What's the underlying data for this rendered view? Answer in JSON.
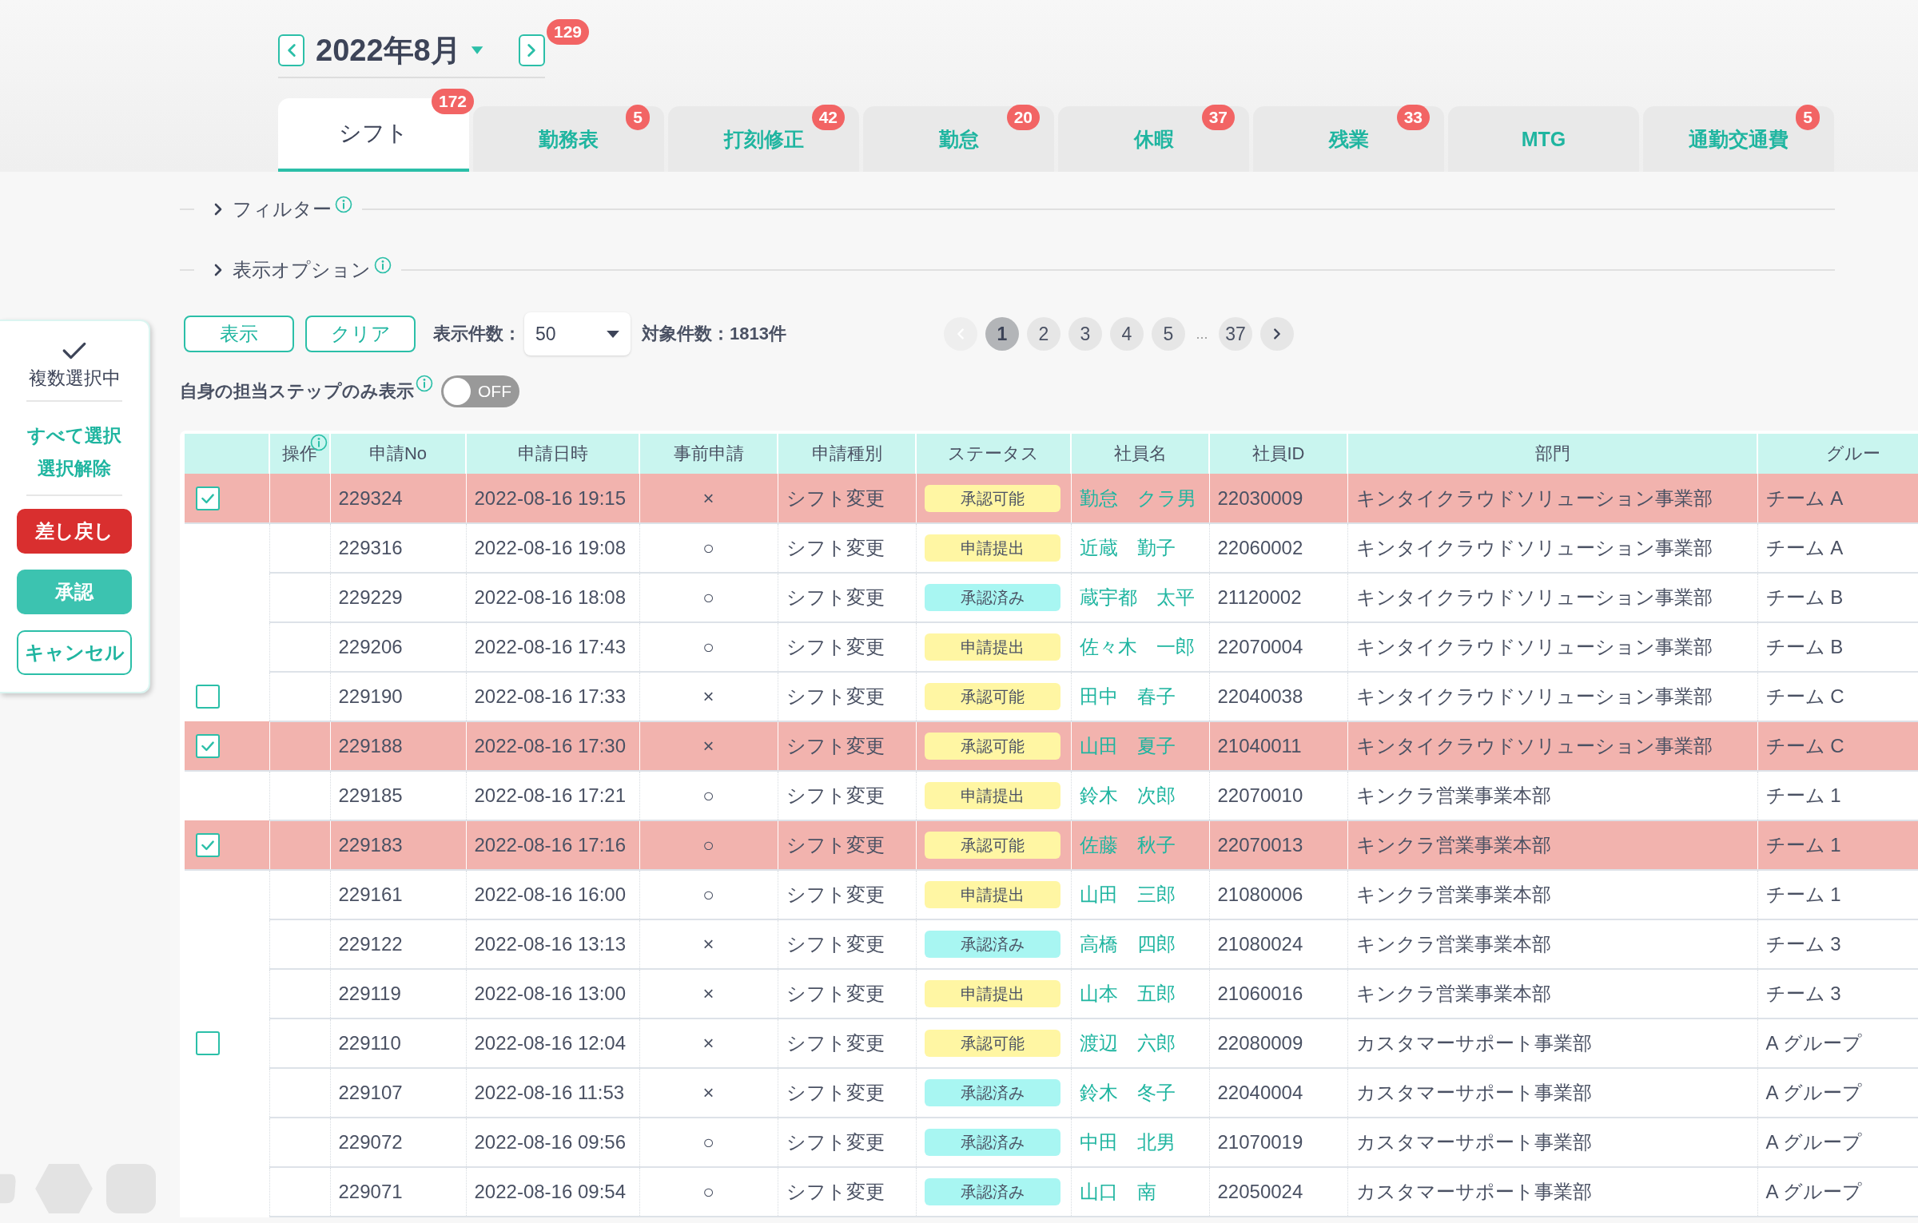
{
  "month_nav": {
    "title": "2022年8月",
    "badge": "129"
  },
  "tabs": [
    {
      "label": "シフト",
      "badge": "172",
      "selected": true
    },
    {
      "label": "勤務表",
      "badge": "5",
      "selected": false
    },
    {
      "label": "打刻修正",
      "badge": "42",
      "selected": false
    },
    {
      "label": "勤怠",
      "badge": "20",
      "selected": false
    },
    {
      "label": "休暇",
      "badge": "37",
      "selected": false
    },
    {
      "label": "残業",
      "badge": "33",
      "selected": false
    },
    {
      "label": "MTG",
      "selected": false
    },
    {
      "label": "通勤交通費",
      "badge": "5",
      "selected": false
    }
  ],
  "sections": [
    {
      "label": "フィルター",
      "expanded": false
    },
    {
      "label": "表示オプション",
      "expanded": false
    }
  ],
  "side_panel": {
    "mode": "複数選択中",
    "links": [
      "すべて選択",
      "選択解除"
    ],
    "buttons": [
      {
        "label": "差し戻し",
        "kind": "danger"
      },
      {
        "label": "承認",
        "kind": "primary"
      },
      {
        "label": "キャンセル",
        "kind": "outline"
      }
    ]
  },
  "toolbar": {
    "buttons": [
      "表示",
      "クリア"
    ],
    "page_size_label": "表示件数：",
    "page_size": "50",
    "total": "対象件数：1813件"
  },
  "pagination": [
    {
      "kind": "prev",
      "disabled": true
    },
    {
      "kind": "page",
      "label": "1",
      "selected": true
    },
    {
      "kind": "page",
      "label": "2",
      "selected": false
    },
    {
      "kind": "page",
      "label": "3",
      "selected": false
    },
    {
      "kind": "page",
      "label": "4",
      "selected": false
    },
    {
      "kind": "page",
      "label": "5",
      "selected": false
    },
    {
      "kind": "ellipsis",
      "label": "..."
    },
    {
      "kind": "page",
      "label": "37",
      "selected": false
    },
    {
      "kind": "next",
      "disabled": false
    }
  ],
  "toggle": {
    "label": "自身の担当ステップのみ表示",
    "on": false,
    "state_label": "OFF"
  },
  "table": {
    "columns": [
      {
        "label": "操作",
        "info": true
      },
      {
        "label": "申請No"
      },
      {
        "label": "申請日時"
      },
      {
        "label": "事前申請"
      },
      {
        "label": "申請種別"
      },
      {
        "label": "ステータス"
      },
      {
        "label": "社員名"
      },
      {
        "label": "社員ID"
      },
      {
        "label": "部門"
      },
      {
        "label": "グルー"
      }
    ],
    "rows": [
      {
        "has_checkbox": true,
        "checked": true,
        "no": "229324",
        "datetime": "2022-08-16 19:15",
        "prior": "×",
        "type": "シフト変更",
        "status": {
          "label": "承認可能",
          "color": "#fff6a3"
        },
        "employee": "勤怠　クラ男",
        "employee_id": "22030009",
        "department": "キンタイクラウドソリューション事業部",
        "group": "チーム A"
      },
      {
        "has_checkbox": false,
        "checked": false,
        "no": "229316",
        "datetime": "2022-08-16 19:08",
        "prior": "○",
        "type": "シフト変更",
        "status": {
          "label": "申請提出",
          "color": "#fff6a3"
        },
        "employee": "近蔵　勤子",
        "employee_id": "22060002",
        "department": "キンタイクラウドソリューション事業部",
        "group": "チーム A"
      },
      {
        "has_checkbox": false,
        "checked": false,
        "no": "229229",
        "datetime": "2022-08-16 18:08",
        "prior": "○",
        "type": "シフト変更",
        "status": {
          "label": "承認済み",
          "color": "#a8f6f2"
        },
        "employee": "蔵宇都　太平",
        "employee_id": "21120002",
        "department": "キンタイクラウドソリューション事業部",
        "group": "チーム B"
      },
      {
        "has_checkbox": false,
        "checked": false,
        "no": "229206",
        "datetime": "2022-08-16 17:43",
        "prior": "○",
        "type": "シフト変更",
        "status": {
          "label": "申請提出",
          "color": "#fff6a3"
        },
        "employee": "佐々木　一郎",
        "employee_id": "22070004",
        "department": "キンタイクラウドソリューション事業部",
        "group": "チーム B"
      },
      {
        "has_checkbox": true,
        "checked": false,
        "no": "229190",
        "datetime": "2022-08-16 17:33",
        "prior": "×",
        "type": "シフト変更",
        "status": {
          "label": "承認可能",
          "color": "#fff6a3"
        },
        "employee": "田中　春子",
        "employee_id": "22040038",
        "department": "キンタイクラウドソリューション事業部",
        "group": "チーム C"
      },
      {
        "has_checkbox": true,
        "checked": true,
        "no": "229188",
        "datetime": "2022-08-16 17:30",
        "prior": "×",
        "type": "シフト変更",
        "status": {
          "label": "承認可能",
          "color": "#fff6a3"
        },
        "employee": "山田　夏子",
        "employee_id": "21040011",
        "department": "キンタイクラウドソリューション事業部",
        "group": "チーム C"
      },
      {
        "has_checkbox": false,
        "checked": false,
        "no": "229185",
        "datetime": "2022-08-16 17:21",
        "prior": "○",
        "type": "シフト変更",
        "status": {
          "label": "申請提出",
          "color": "#fff6a3"
        },
        "employee": "鈴木　次郎",
        "employee_id": "22070010",
        "department": "キンクラ営業事業本部",
        "group": "チーム 1"
      },
      {
        "has_checkbox": true,
        "checked": true,
        "no": "229183",
        "datetime": "2022-08-16 17:16",
        "prior": "○",
        "type": "シフト変更",
        "status": {
          "label": "承認可能",
          "color": "#fff6a3"
        },
        "employee": "佐藤　秋子",
        "employee_id": "22070013",
        "department": "キンクラ営業事業本部",
        "group": "チーム 1"
      },
      {
        "has_checkbox": false,
        "checked": false,
        "no": "229161",
        "datetime": "2022-08-16 16:00",
        "prior": "○",
        "type": "シフト変更",
        "status": {
          "label": "申請提出",
          "color": "#fff6a3"
        },
        "employee": "山田　三郎",
        "employee_id": "21080006",
        "department": "キンクラ営業事業本部",
        "group": "チーム 1"
      },
      {
        "has_checkbox": false,
        "checked": false,
        "no": "229122",
        "datetime": "2022-08-16 13:13",
        "prior": "×",
        "type": "シフト変更",
        "status": {
          "label": "承認済み",
          "color": "#a8f6f2"
        },
        "employee": "高橋　四郎",
        "employee_id": "21080024",
        "department": "キンクラ営業事業本部",
        "group": "チーム 3"
      },
      {
        "has_checkbox": false,
        "checked": false,
        "no": "229119",
        "datetime": "2022-08-16 13:00",
        "prior": "×",
        "type": "シフト変更",
        "status": {
          "label": "申請提出",
          "color": "#fff6a3"
        },
        "employee": "山本　五郎",
        "employee_id": "21060016",
        "department": "キンクラ営業事業本部",
        "group": "チーム 3"
      },
      {
        "has_checkbox": true,
        "checked": false,
        "no": "229110",
        "datetime": "2022-08-16 12:04",
        "prior": "×",
        "type": "シフト変更",
        "status": {
          "label": "承認可能",
          "color": "#fff6a3"
        },
        "employee": "渡辺　六郎",
        "employee_id": "22080009",
        "department": "カスタマーサポート事業部",
        "group": "A グループ"
      },
      {
        "has_checkbox": false,
        "checked": false,
        "no": "229107",
        "datetime": "2022-08-16 11:53",
        "prior": "×",
        "type": "シフト変更",
        "status": {
          "label": "承認済み",
          "color": "#a8f6f2"
        },
        "employee": "鈴木　冬子",
        "employee_id": "22040004",
        "department": "カスタマーサポート事業部",
        "group": "A グループ"
      },
      {
        "has_checkbox": false,
        "checked": false,
        "no": "229072",
        "datetime": "2022-08-16 09:56",
        "prior": "○",
        "type": "シフト変更",
        "status": {
          "label": "承認済み",
          "color": "#a8f6f2"
        },
        "employee": "中田　北男",
        "employee_id": "21070019",
        "department": "カスタマーサポート事業部",
        "group": "A グループ"
      },
      {
        "has_checkbox": false,
        "checked": false,
        "no": "229071",
        "datetime": "2022-08-16 09:54",
        "prior": "○",
        "type": "シフト変更",
        "status": {
          "label": "承認済み",
          "color": "#a8f6f2"
        },
        "employee": "山口　南",
        "employee_id": "22050024",
        "department": "カスタマーサポート事業部",
        "group": "A グループ"
      }
    ]
  }
}
